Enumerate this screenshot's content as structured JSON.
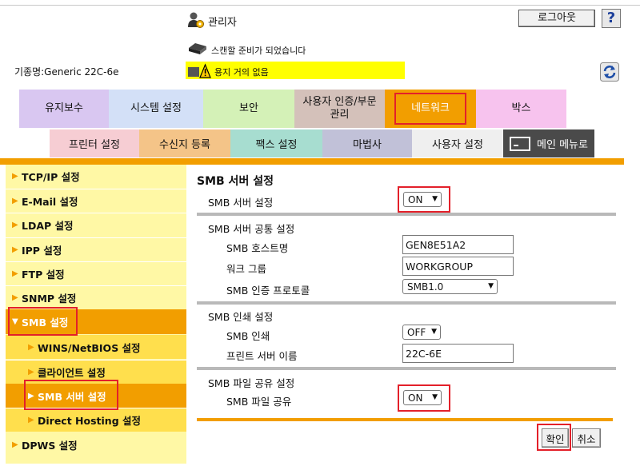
{
  "header": {
    "admin_label": "관리자",
    "logout_label": "로그아웃",
    "help_label": "?",
    "scan_status": "스캔할 준비가 되었습니다",
    "model": "기종명:Generic 22C-6e",
    "warning": "용지 거의 없음"
  },
  "tabs": {
    "maintenance": "유지보수",
    "system": "시스템 설정",
    "security": "보안",
    "auth_line1": "사용자 인증/부문",
    "auth_line2": "관리",
    "network": "네트워크",
    "box": "박스"
  },
  "subtabs": {
    "printer": "프린터 설정",
    "destination": "수신지 등록",
    "fax": "팩스 설정",
    "wizard": "마법사",
    "user": "사용자 설정",
    "main_menu": "메인 메뉴로"
  },
  "sidebar": {
    "tcpip": "TCP/IP 설정",
    "email": "E-Mail 설정",
    "ldap": "LDAP 설정",
    "ipp": "IPP 설정",
    "ftp": "FTP 설정",
    "snmp": "SNMP 설정",
    "smb": "SMB 설정",
    "wins": "WINS/NetBIOS 설정",
    "client": "클라이언트 설정",
    "smb_server": "SMB 서버 설정",
    "direct_hosting": "Direct Hosting 설정",
    "dpws": "DPWS 설정"
  },
  "main": {
    "title": "SMB 서버 설정",
    "server_setting_label": "SMB 서버 설정",
    "server_setting_value": "ON",
    "common_section": "SMB 서버 공통 설정",
    "hostname_label": "SMB 호스트명",
    "hostname_value": "GEN8E51A2",
    "workgroup_label": "워크 그룹",
    "workgroup_value": "WORKGROUP",
    "auth_protocol_label": "SMB 인증 프로토콜",
    "auth_protocol_value": "SMB1.0",
    "print_section": "SMB 인쇄 설정",
    "print_label": "SMB 인쇄",
    "print_value": "OFF",
    "print_server_label": "프린트 서버 이름",
    "print_server_value": "22C-6E",
    "share_section": "SMB 파일 공유 설정",
    "share_label": "SMB 파일 공유",
    "share_value": "ON",
    "ok_label": "확인",
    "cancel_label": "취소"
  },
  "colors": {
    "accent_orange": "#f29e00",
    "highlight_red": "#e3202a",
    "sidebar_bg": "#fff8a5",
    "warning_yellow": "#ffff00"
  }
}
